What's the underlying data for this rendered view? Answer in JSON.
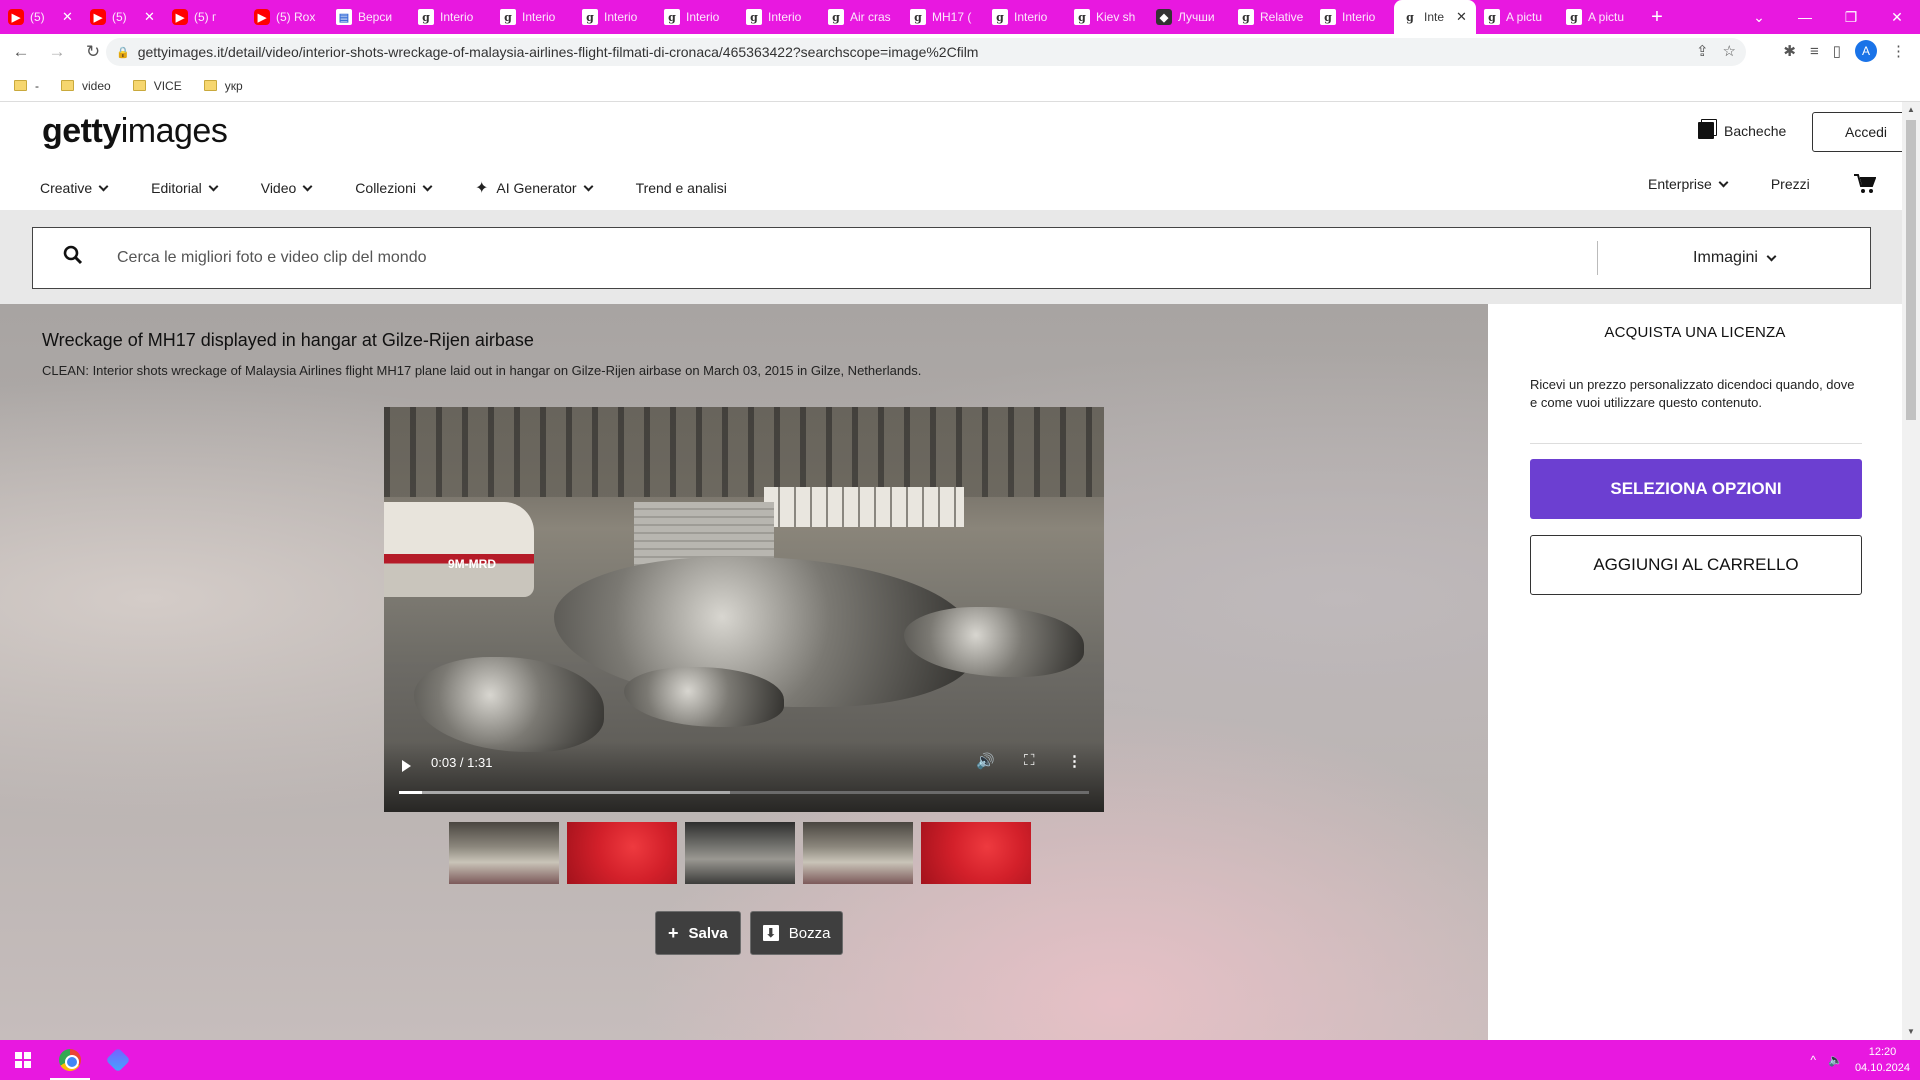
{
  "browser": {
    "tabs": [
      {
        "icon": "youtube-icon",
        "title": "(5)"
      },
      {
        "icon": "youtube-icon",
        "title": "(5)"
      },
      {
        "icon": "youtube-icon",
        "title": "(5) г"
      },
      {
        "icon": "youtube-icon",
        "title": "(5) Rox"
      },
      {
        "icon": "document-icon",
        "title": "Верси"
      },
      {
        "icon": "getty-icon",
        "title": "Interio"
      },
      {
        "icon": "getty-icon",
        "title": "Interio"
      },
      {
        "icon": "getty-icon",
        "title": "Interio"
      },
      {
        "icon": "getty-icon",
        "title": "Interio"
      },
      {
        "icon": "getty-icon",
        "title": "Interio"
      },
      {
        "icon": "getty-icon",
        "title": "Air cras"
      },
      {
        "icon": "getty-icon",
        "title": "MH17 ("
      },
      {
        "icon": "getty-icon",
        "title": "Interio"
      },
      {
        "icon": "getty-icon",
        "title": "Kiev sh"
      },
      {
        "icon": "cube-icon",
        "title": "Лучши"
      },
      {
        "icon": "getty-icon",
        "title": "Relative"
      },
      {
        "icon": "getty-icon",
        "title": "Interio"
      },
      {
        "icon": "getty-icon",
        "title": "Inte",
        "active": true
      },
      {
        "icon": "getty-icon",
        "title": "A pictu"
      },
      {
        "icon": "getty-icon",
        "title": "A pictu"
      }
    ],
    "url": "gettyimages.it/detail/video/interior-shots-wreckage-of-malaysia-airlines-flight-filmati-di-cronaca/465363422?searchscope=image%2Cfilm",
    "profile_initial": "A",
    "bookmarks": [
      {
        "label": "-"
      },
      {
        "label": "video"
      },
      {
        "label": "VICE"
      },
      {
        "label": "укр"
      }
    ]
  },
  "header": {
    "logo_bold": "getty",
    "logo_light": "images",
    "boards_label": "Bacheche",
    "signin_label": "Accedi",
    "nav": [
      "Creative",
      "Editorial",
      "Video",
      "Collezioni"
    ],
    "ai_generator": "AI Generator",
    "trends": "Trend e analisi",
    "enterprise": "Enterprise",
    "pricing": "Prezzi"
  },
  "search": {
    "placeholder": "Cerca le migliori foto e video clip del mondo",
    "type_label": "Immagini"
  },
  "asset": {
    "title": "Wreckage of MH17 displayed in hangar at Gilze-Rijen airbase",
    "caption": "CLEAN: Interior shots wreckage of Malaysia Airlines flight MH17 plane laid out in hangar on Gilze-Rijen airbase on March 03, 2015 in Gilze, Netherlands.",
    "registration_text": "9M-MRD",
    "player": {
      "timecode": "0:03 / 1:31",
      "played_fraction": 0.034,
      "buffered_fraction": 0.48
    },
    "thumbnails": [
      "wreckage-hangar",
      "red-fragment",
      "people-in-hangar",
      "wreckage-hangar",
      "red-fragment"
    ],
    "save_label": "Salva",
    "comp_label": "Bozza"
  },
  "license": {
    "title": "ACQUISTA UNA LICENZA",
    "description": "Ricevi un prezzo personalizzato dicendoci quando, dove e come vuoi utilizzare questo contenuto.",
    "select_options": "SELEZIONA OPZIONI",
    "add_to_cart": "AGGIUNGI AL CARRELLO",
    "accent_color": "#6c3fd1"
  },
  "taskbar": {
    "time": "12:20",
    "date": "04.10.2024"
  }
}
